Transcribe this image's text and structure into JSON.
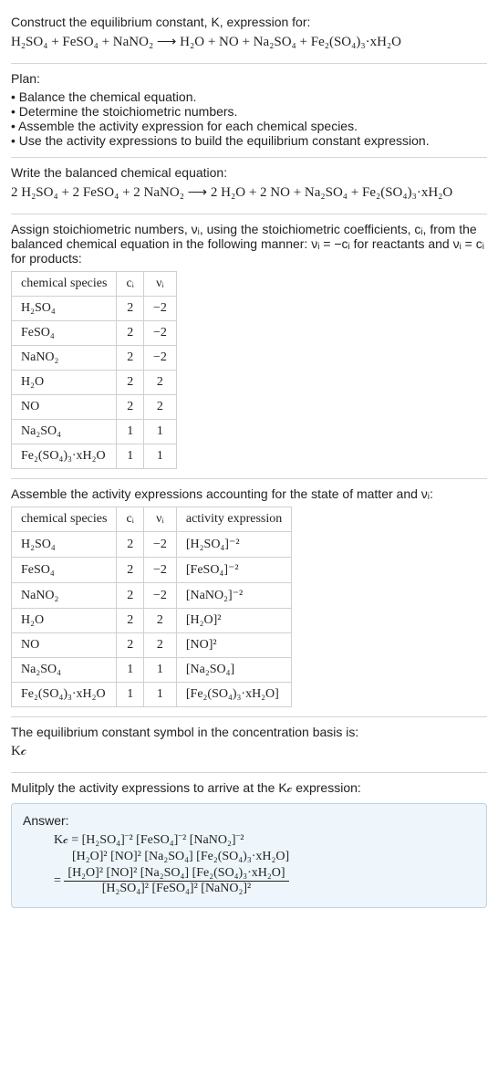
{
  "header": {
    "line1": "Construct the equilibrium constant, K, expression for:",
    "equation": "H₂SO₄ + FeSO₄ + NaNO₂  ⟶  H₂O + NO + Na₂SO₄ + Fe₂(SO₄)₃·xH₂O"
  },
  "plan": {
    "title": "Plan:",
    "items": [
      "Balance the chemical equation.",
      "Determine the stoichiometric numbers.",
      "Assemble the activity expression for each chemical species.",
      "Use the activity expressions to build the equilibrium constant expression."
    ]
  },
  "balanced": {
    "intro": "Write the balanced chemical equation:",
    "equation": "2 H₂SO₄ + 2 FeSO₄ + 2 NaNO₂  ⟶  2 H₂O + 2 NO + Na₂SO₄ + Fe₂(SO₄)₃·xH₂O"
  },
  "stoich": {
    "intro": "Assign stoichiometric numbers, νᵢ, using the stoichiometric coefficients, cᵢ, from the balanced chemical equation in the following manner: νᵢ = −cᵢ for reactants and νᵢ = cᵢ for products:",
    "headers": {
      "species": "chemical species",
      "ci": "cᵢ",
      "vi": "νᵢ"
    },
    "rows": [
      {
        "species": "H₂SO₄",
        "ci": "2",
        "vi": "−2"
      },
      {
        "species": "FeSO₄",
        "ci": "2",
        "vi": "−2"
      },
      {
        "species": "NaNO₂",
        "ci": "2",
        "vi": "−2"
      },
      {
        "species": "H₂O",
        "ci": "2",
        "vi": "2"
      },
      {
        "species": "NO",
        "ci": "2",
        "vi": "2"
      },
      {
        "species": "Na₂SO₄",
        "ci": "1",
        "vi": "1"
      },
      {
        "species": "Fe₂(SO₄)₃·xH₂O",
        "ci": "1",
        "vi": "1"
      }
    ]
  },
  "activity": {
    "intro": "Assemble the activity expressions accounting for the state of matter and νᵢ:",
    "headers": {
      "species": "chemical species",
      "ci": "cᵢ",
      "vi": "νᵢ",
      "act": "activity expression"
    },
    "rows": [
      {
        "species": "H₂SO₄",
        "ci": "2",
        "vi": "−2",
        "act": "[H₂SO₄]⁻²"
      },
      {
        "species": "FeSO₄",
        "ci": "2",
        "vi": "−2",
        "act": "[FeSO₄]⁻²"
      },
      {
        "species": "NaNO₂",
        "ci": "2",
        "vi": "−2",
        "act": "[NaNO₂]⁻²"
      },
      {
        "species": "H₂O",
        "ci": "2",
        "vi": "2",
        "act": "[H₂O]²"
      },
      {
        "species": "NO",
        "ci": "2",
        "vi": "2",
        "act": "[NO]²"
      },
      {
        "species": "Na₂SO₄",
        "ci": "1",
        "vi": "1",
        "act": "[Na₂SO₄]"
      },
      {
        "species": "Fe₂(SO₄)₃·xH₂O",
        "ci": "1",
        "vi": "1",
        "act": "[Fe₂(SO₄)₃·xH₂O]"
      }
    ]
  },
  "kc_label": {
    "intro": "The equilibrium constant symbol in the concentration basis is:",
    "symbol": "K𝒸"
  },
  "multiply": {
    "intro": "Mulitply the activity expressions to arrive at the K𝒸 expression:"
  },
  "answer": {
    "title": "Answer:",
    "line1": "K𝒸 = [H₂SO₄]⁻² [FeSO₄]⁻² [NaNO₂]⁻²",
    "line2": "[H₂O]² [NO]² [Na₂SO₄] [Fe₂(SO₄)₃·xH₂O]",
    "frac_num": "[H₂O]² [NO]² [Na₂SO₄] [Fe₂(SO₄)₃·xH₂O]",
    "frac_den": "[H₂SO₄]² [FeSO₄]² [NaNO₂]²",
    "eq": "= "
  },
  "chart_data": {
    "type": "table",
    "tables": [
      {
        "title": "Stoichiometric numbers",
        "columns": [
          "chemical species",
          "cᵢ",
          "νᵢ"
        ],
        "rows": [
          [
            "H₂SO₄",
            2,
            -2
          ],
          [
            "FeSO₄",
            2,
            -2
          ],
          [
            "NaNO₂",
            2,
            -2
          ],
          [
            "H₂O",
            2,
            2
          ],
          [
            "NO",
            2,
            2
          ],
          [
            "Na₂SO₄",
            1,
            1
          ],
          [
            "Fe₂(SO₄)₃·xH₂O",
            1,
            1
          ]
        ]
      },
      {
        "title": "Activity expressions",
        "columns": [
          "chemical species",
          "cᵢ",
          "νᵢ",
          "activity expression"
        ],
        "rows": [
          [
            "H₂SO₄",
            2,
            -2,
            "[H₂SO₄]^-2"
          ],
          [
            "FeSO₄",
            2,
            -2,
            "[FeSO₄]^-2"
          ],
          [
            "NaNO₂",
            2,
            -2,
            "[NaNO₂]^-2"
          ],
          [
            "H₂O",
            2,
            2,
            "[H₂O]^2"
          ],
          [
            "NO",
            2,
            2,
            "[NO]^2"
          ],
          [
            "Na₂SO₄",
            1,
            1,
            "[Na₂SO₄]"
          ],
          [
            "Fe₂(SO₄)₃·xH₂O",
            1,
            1,
            "[Fe₂(SO₄)₃·xH₂O]"
          ]
        ]
      }
    ]
  }
}
